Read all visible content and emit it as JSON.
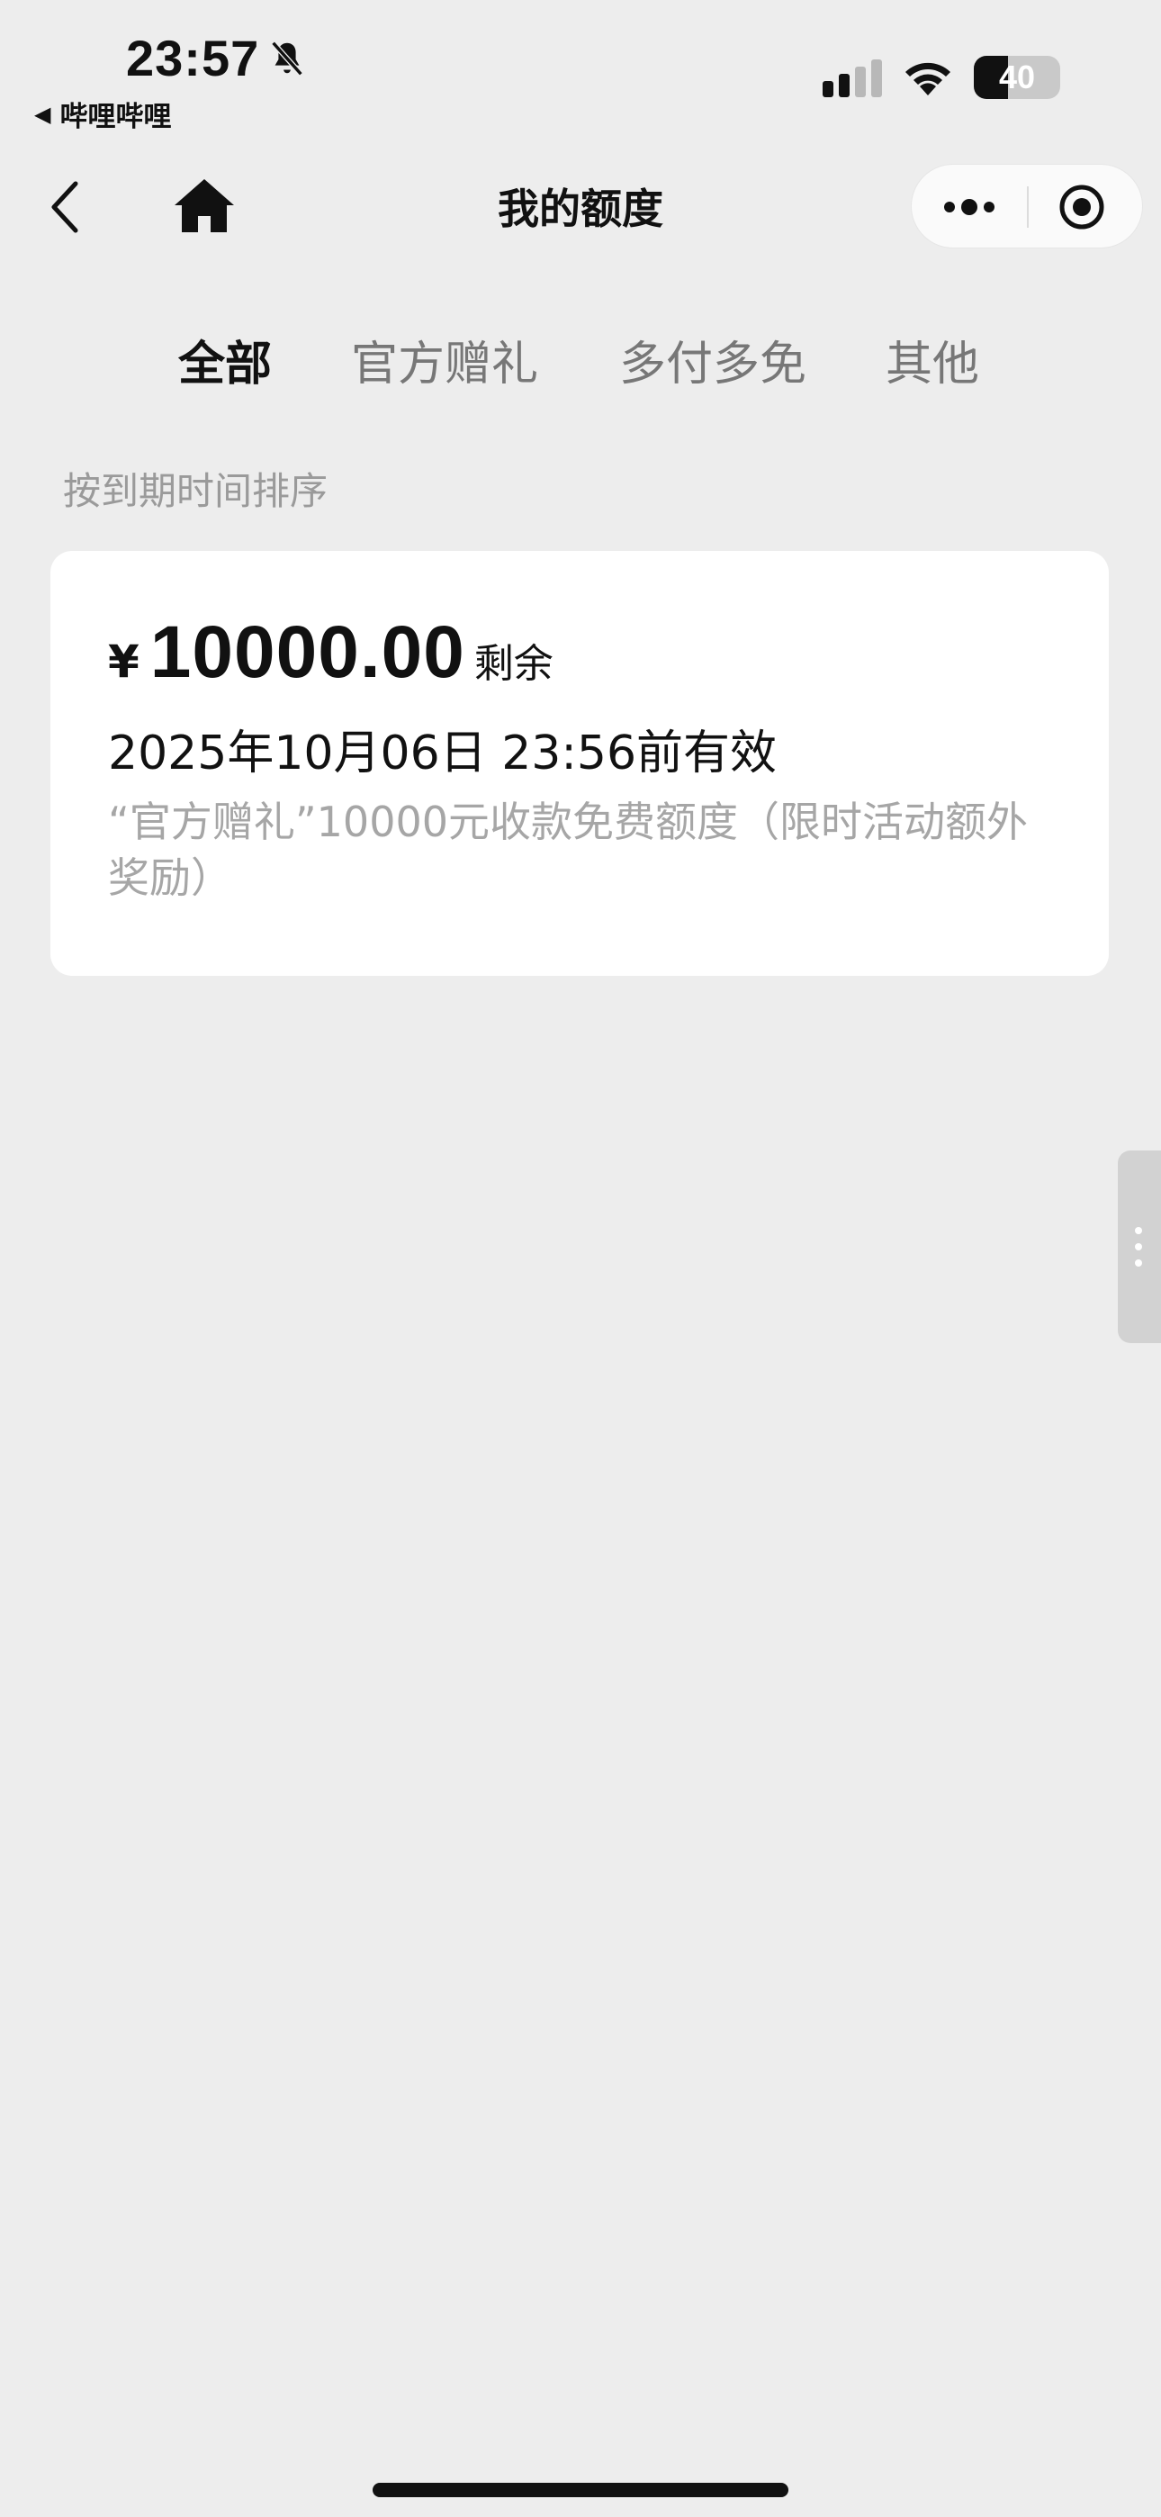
{
  "status_bar": {
    "time": "23:57",
    "back_app": "哔哩哔哩",
    "battery_level": 40,
    "battery_text": "40",
    "icons": [
      "bell-slash-icon",
      "signal-icon",
      "wifi-icon",
      "battery-icon"
    ]
  },
  "nav": {
    "title": "我的额度",
    "back_icon": "chevron-left-icon",
    "home_icon": "home-icon",
    "more_icon": "more-dots-icon",
    "close_icon": "target-close-icon"
  },
  "tabs": [
    {
      "label": "全部",
      "active": true
    },
    {
      "label": "官方赠礼",
      "active": false
    },
    {
      "label": "多付多免",
      "active": false
    },
    {
      "label": "其他",
      "active": false
    }
  ],
  "sort_label": "按到期时间排序",
  "quota_card": {
    "currency": "¥",
    "amount": "10000.00",
    "remaining_label": "剩余",
    "valid_until": "2025年10月06日 23:56前有效",
    "description": "“官方赠礼”10000元收款免费额度（限时活动额外奖励）"
  },
  "colors": {
    "background": "#ededed",
    "card": "#ffffff",
    "text_primary": "#111111",
    "text_secondary": "#a6a6a6"
  }
}
